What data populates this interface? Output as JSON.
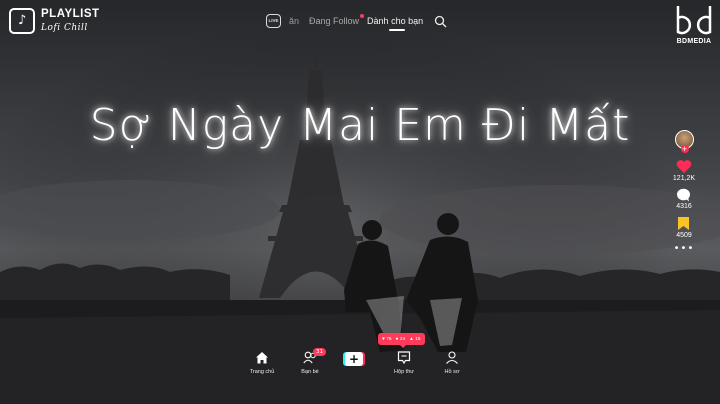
{
  "playlist": {
    "title": "PLAYLIST",
    "subtitle": "Lofi Chill",
    "icon": "music-note-icon"
  },
  "nav": {
    "live_label": "LIVE",
    "tab_partial": "ăn",
    "tab_following": "Đang Follow",
    "tab_foryou": "Dành cho bạn",
    "search_icon": "search-icon"
  },
  "logo": {
    "caption": "BDMEDIA"
  },
  "video_title": "Sợ Ngày Mai Em Đi Mất",
  "rail": {
    "likes": "121,2K",
    "comments": "4316",
    "saves": "4509",
    "more": "•••"
  },
  "bottom_nav": {
    "home": "Trang chủ",
    "friends": "Bạn bè",
    "friends_badge": "31",
    "create": "+",
    "inbox": "Hộp thư",
    "profile": "Hồ sơ"
  },
  "notification": {
    "likes": "75",
    "comments": "24",
    "followers": "16"
  },
  "colors": {
    "accent": "#ff3b5c",
    "cyan": "#25f4ee",
    "red": "#fe2c55",
    "save": "#f7c325"
  }
}
